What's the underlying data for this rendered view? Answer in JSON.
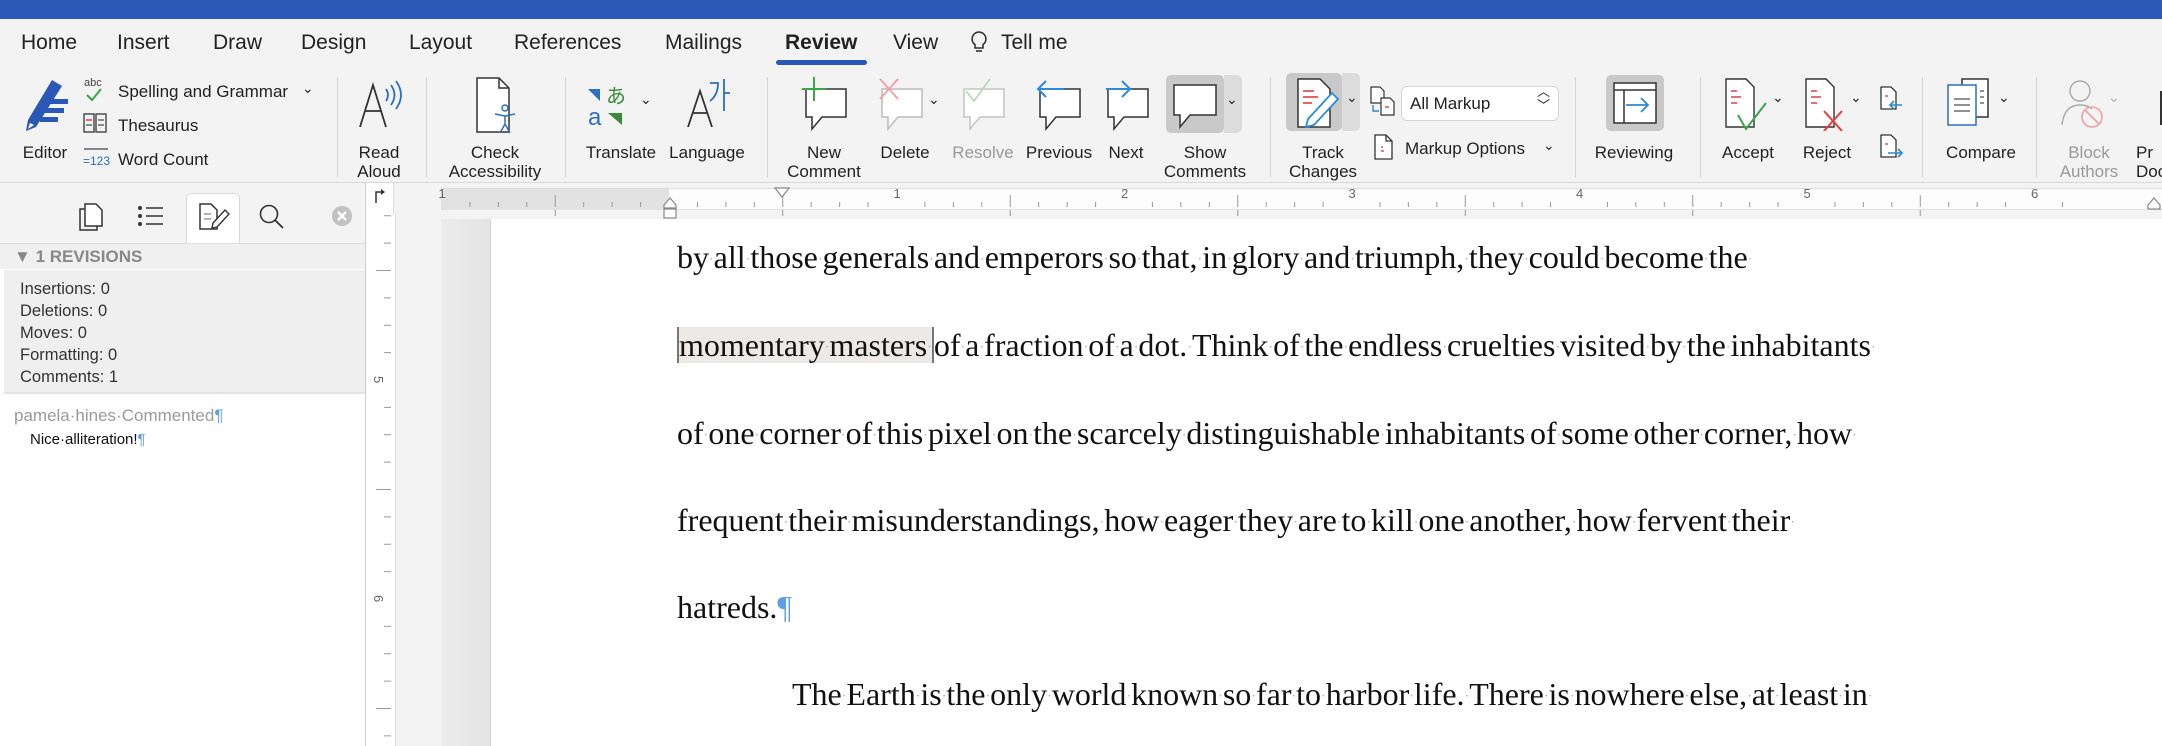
{
  "tabs": [
    {
      "label": "Home"
    },
    {
      "label": "Insert"
    },
    {
      "label": "Draw"
    },
    {
      "label": "Design"
    },
    {
      "label": "Layout"
    },
    {
      "label": "References"
    },
    {
      "label": "Mailings"
    },
    {
      "label": "Review",
      "active": true
    },
    {
      "label": "View"
    },
    {
      "label": "Tell me"
    }
  ],
  "ribbon": {
    "editor": "Editor",
    "spelling": "Spelling and Grammar",
    "thesaurus": "Thesaurus",
    "word_count": "Word Count",
    "read_aloud": [
      "Read",
      "Aloud"
    ],
    "check_accessibility": [
      "Check",
      "Accessibility"
    ],
    "translate": "Translate",
    "language": "Language",
    "new_comment": [
      "New",
      "Comment"
    ],
    "delete": "Delete",
    "resolve": "Resolve",
    "previous": "Previous",
    "next": "Next",
    "show_comments": [
      "Show",
      "Comments"
    ],
    "track_changes": [
      "Track",
      "Changes"
    ],
    "markup_select": "All Markup",
    "markup_options": "Markup Options",
    "reviewing": "Reviewing",
    "accept": "Accept",
    "reject": "Reject",
    "compare": "Compare",
    "block_authors": [
      "Block",
      "Authors"
    ],
    "protect_document": [
      "Pr",
      "Doc"
    ]
  },
  "pane": {
    "revisions_header": "1 REVISIONS",
    "stats": [
      "Insertions: 0",
      "Deletions: 0",
      "Moves: 0",
      "Formatting: 0",
      "Comments: 1"
    ],
    "comment": {
      "author_line": "pamela·hines·Commented",
      "text": "Nice·alliteration!"
    }
  },
  "rulers": {
    "horizontal_numbers": [
      "1",
      "1",
      "2",
      "3",
      "4",
      "5",
      "6"
    ],
    "vertical_numbers": [
      "5",
      "6"
    ]
  },
  "document": {
    "lines": [
      "by all those generals and emperors so that, in glory and triumph, they could become the",
      "of a fraction of a dot. Think of the endless cruelties visited by the inhabitants",
      "of one corner of this pixel on the scarcely distinguishable inhabitants of some other corner, how",
      "frequent their misunderstandings, how eager they are to kill one another, how fervent their",
      "hatreds.",
      "The Earth is the only world known so far to harbor life. There is nowhere else, at least in"
    ],
    "comment_anchor": "momentary masters"
  },
  "colors": {
    "accent": "#2b58b6",
    "formatting_marks": "#5b9fe6",
    "comment_highlight": "#ece9e6"
  }
}
